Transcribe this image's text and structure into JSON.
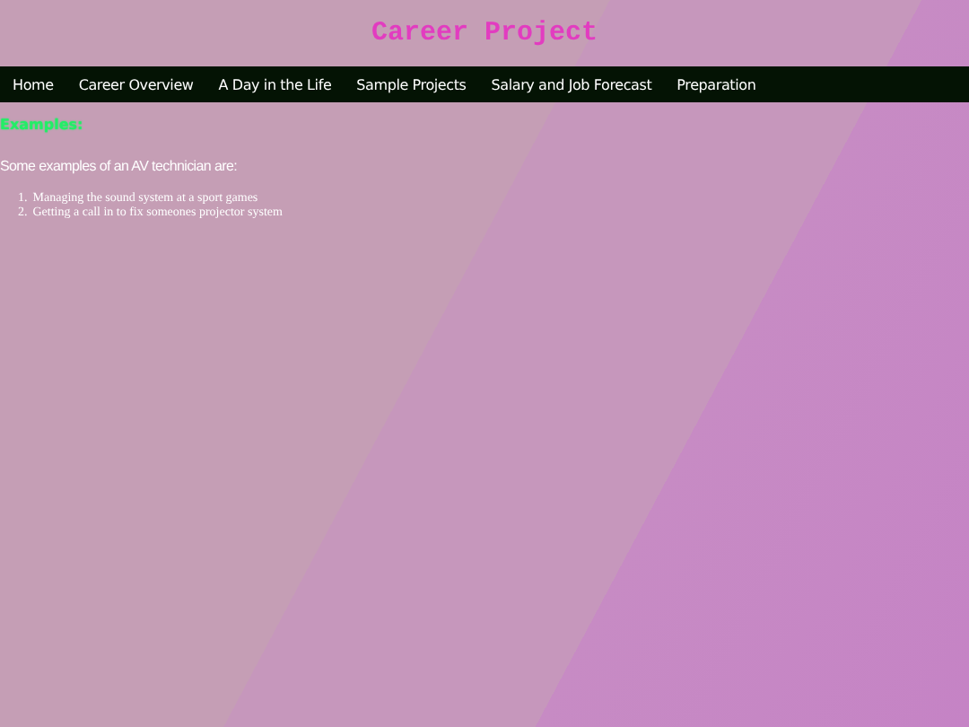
{
  "header": {
    "title": "Career Project"
  },
  "nav": {
    "items": [
      {
        "label": "Home"
      },
      {
        "label": "Career Overview"
      },
      {
        "label": "A Day in the Life"
      },
      {
        "label": "Sample Projects"
      },
      {
        "label": "Salary and Job Forecast"
      },
      {
        "label": "Preparation"
      }
    ]
  },
  "content": {
    "heading": "Examples:",
    "intro": "Some examples of an AV technician are:",
    "list": [
      {
        "number": "1.",
        "text": "Managing the sound system at a sport games"
      },
      {
        "number": "2.",
        "text": "Getting a call in to fix someones projector system"
      }
    ]
  }
}
